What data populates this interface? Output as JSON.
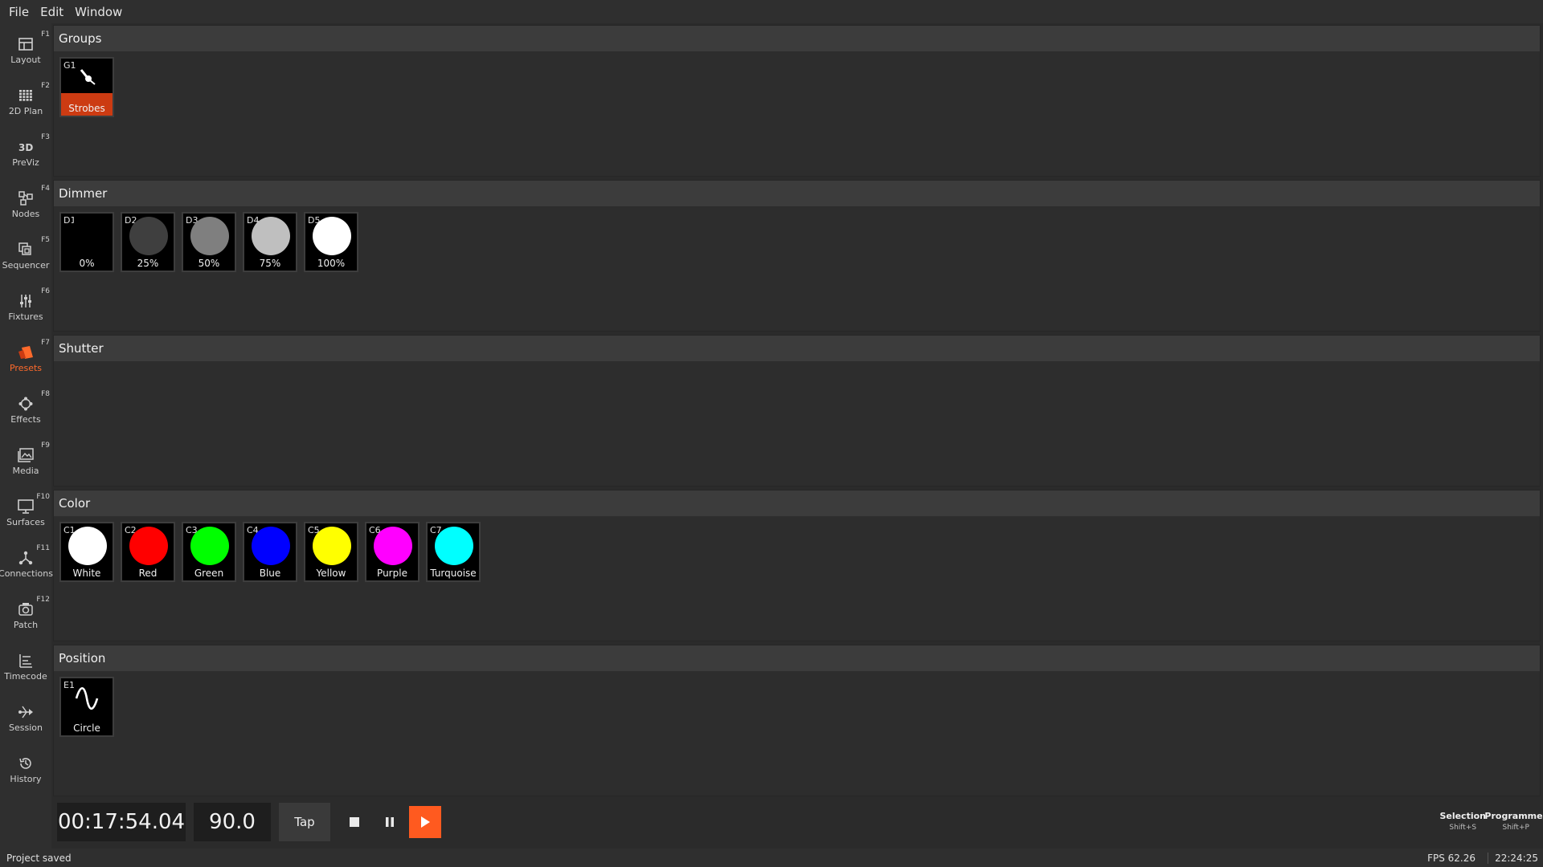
{
  "menubar": [
    "File",
    "Edit",
    "Window"
  ],
  "sidebar": [
    {
      "label": "Layout",
      "fkey": "F1",
      "icon": "layout-icon"
    },
    {
      "label": "2D Plan",
      "fkey": "F2",
      "icon": "grid-icon"
    },
    {
      "label": "PreViz",
      "fkey": "F3",
      "icon": "3d-icon"
    },
    {
      "label": "Nodes",
      "fkey": "F4",
      "icon": "nodes-icon"
    },
    {
      "label": "Sequencer",
      "fkey": "F5",
      "icon": "sequencer-icon"
    },
    {
      "label": "Fixtures",
      "fkey": "F6",
      "icon": "sliders-icon"
    },
    {
      "label": "Presets",
      "fkey": "F7",
      "icon": "presets-icon",
      "active": true
    },
    {
      "label": "Effects",
      "fkey": "F8",
      "icon": "effects-icon"
    },
    {
      "label": "Media",
      "fkey": "F9",
      "icon": "media-icon"
    },
    {
      "label": "Surfaces",
      "fkey": "F10",
      "icon": "monitor-icon"
    },
    {
      "label": "Connections",
      "fkey": "F11",
      "icon": "connections-icon"
    },
    {
      "label": "Patch",
      "fkey": "F12",
      "icon": "patch-icon"
    },
    {
      "label": "Timecode",
      "fkey": "",
      "icon": "timecode-icon"
    },
    {
      "label": "Session",
      "fkey": "",
      "icon": "session-icon"
    },
    {
      "label": "History",
      "fkey": "",
      "icon": "history-icon"
    }
  ],
  "sections": [
    {
      "title": "Groups",
      "tiles": [
        {
          "id": "G1",
          "name": "Strobes",
          "kind": "group",
          "band": "#cc3b12"
        }
      ]
    },
    {
      "title": "Dimmer",
      "tiles": [
        {
          "id": "D1",
          "name": "0%",
          "color": "#000000"
        },
        {
          "id": "D2",
          "name": "25%",
          "color": "#3f3f3f"
        },
        {
          "id": "D3",
          "name": "50%",
          "color": "#7f7f7f"
        },
        {
          "id": "D4",
          "name": "75%",
          "color": "#bfbfbf"
        },
        {
          "id": "D5",
          "name": "100%",
          "color": "#ffffff"
        }
      ]
    },
    {
      "title": "Shutter",
      "tiles": []
    },
    {
      "title": "Color",
      "tiles": [
        {
          "id": "C1",
          "name": "White",
          "color": "#ffffff"
        },
        {
          "id": "C2",
          "name": "Red",
          "color": "#ff0000"
        },
        {
          "id": "C3",
          "name": "Green",
          "color": "#00ff00"
        },
        {
          "id": "C4",
          "name": "Blue",
          "color": "#0000ff"
        },
        {
          "id": "C5",
          "name": "Yellow",
          "color": "#ffff00"
        },
        {
          "id": "C6",
          "name": "Purple",
          "color": "#ff00ff"
        },
        {
          "id": "C7",
          "name": "Turquoise",
          "color": "#00ffff"
        }
      ]
    },
    {
      "title": "Position",
      "tiles": [
        {
          "id": "E1",
          "name": "Circle",
          "kind": "effect"
        }
      ]
    }
  ],
  "transport": {
    "timecode": "00:17:54.04",
    "bpm": "90.0",
    "tap_label": "Tap",
    "accent": "#ff5a1f"
  },
  "right": {
    "selection_label": "Selection",
    "selection_shortcut": "Shift+S",
    "programmer_label": "Programmer",
    "programmer_shortcut": "Shift+P"
  },
  "status": {
    "message": "Project saved",
    "fps": "FPS 62.26",
    "clock": "22:24:25"
  }
}
